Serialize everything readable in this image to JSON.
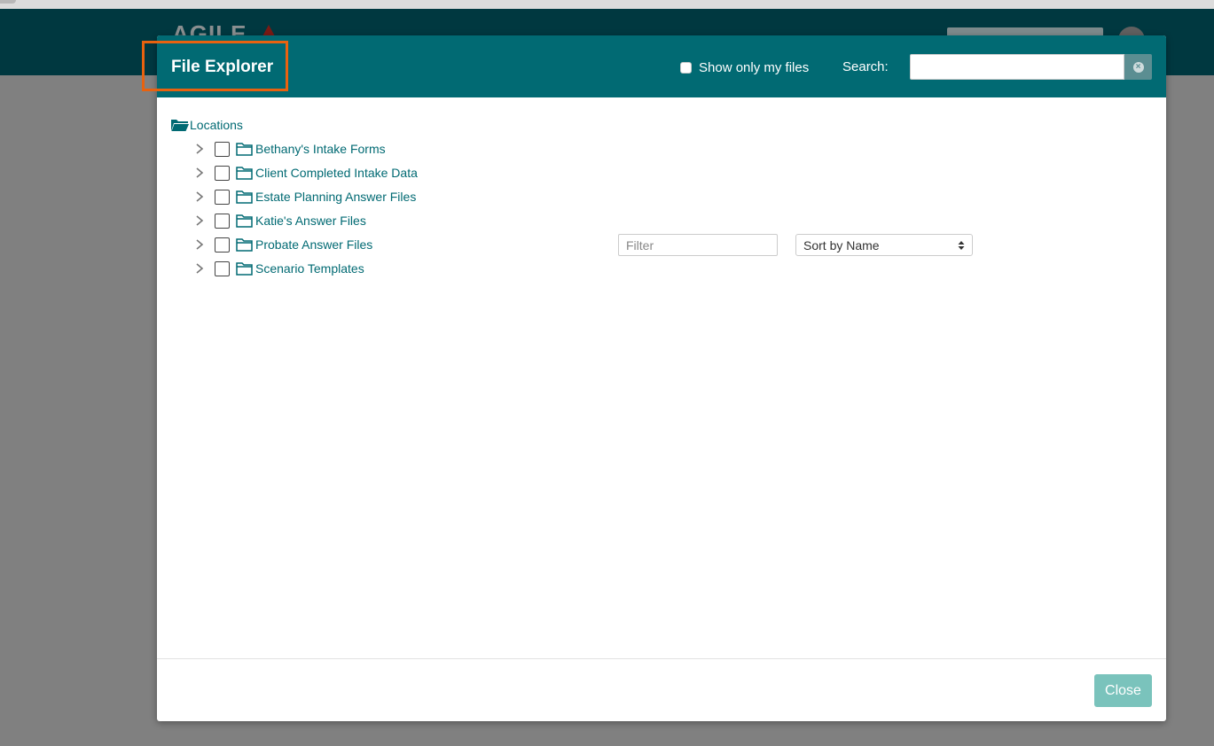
{
  "app": {
    "logo_text": "AGILE"
  },
  "modal": {
    "title": "File Explorer",
    "show_only_my_files_label": "Show only my files",
    "show_only_my_files_checked": false,
    "search_label": "Search:",
    "search_value": "",
    "close_label": "Close"
  },
  "tree": {
    "root_label": "Locations",
    "items": [
      {
        "label": "Bethany's Intake Forms"
      },
      {
        "label": "Client Completed Intake Data"
      },
      {
        "label": "Estate Planning Answer Files"
      },
      {
        "label": "Katie's Answer Files"
      },
      {
        "label": "Probate Answer Files"
      },
      {
        "label": "Scenario Templates"
      }
    ]
  },
  "filter": {
    "placeholder": "Filter",
    "value": ""
  },
  "sort": {
    "selected": "Sort by Name"
  },
  "colors": {
    "header_teal": "#016a73",
    "app_header": "#003840",
    "highlight": "#e8620f",
    "close_button": "#7ac3bc",
    "link": "#016a73"
  },
  "icons": {
    "root": "folder-open-icon",
    "item": "folder-icon",
    "expand": "chevron-right-icon",
    "clear": "clear-circle-icon",
    "sort": "sort-arrows-icon"
  }
}
